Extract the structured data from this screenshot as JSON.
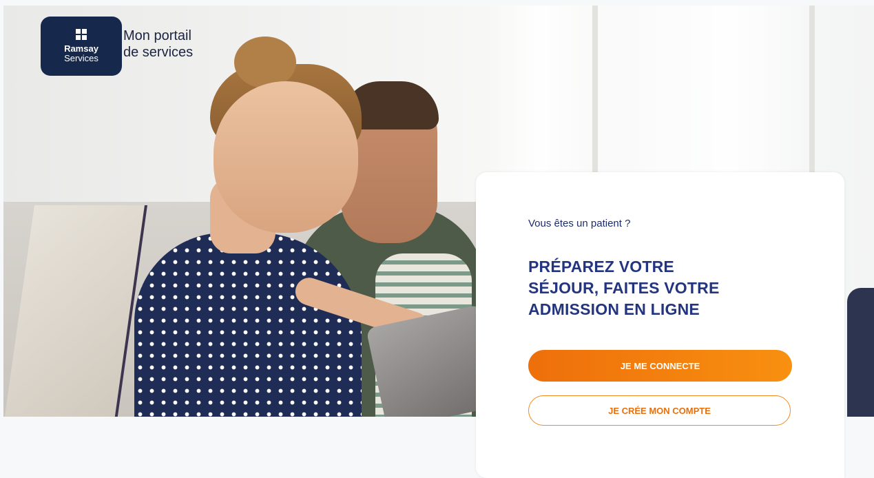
{
  "brand": {
    "logo_name": "Ramsay",
    "logo_sub": "Services",
    "portal_title_line1": "Mon portail",
    "portal_title_line2": "de services"
  },
  "card": {
    "subtitle": "Vous êtes un patient ?",
    "title_lines": [
      "PRÉPAREZ VOTRE",
      "SÉJOUR, FAITES VOTRE",
      "ADMISSION EN LIGNE"
    ],
    "login_label": "JE ME CONNECTE",
    "signup_label": "JE CRÉE MON COMPTE"
  },
  "colors": {
    "brand_navy": "#16294d",
    "title_blue": "#23357f",
    "accent_orange": "#f07a0c"
  },
  "icons": {
    "logo": "ramsay-logo-icon"
  }
}
